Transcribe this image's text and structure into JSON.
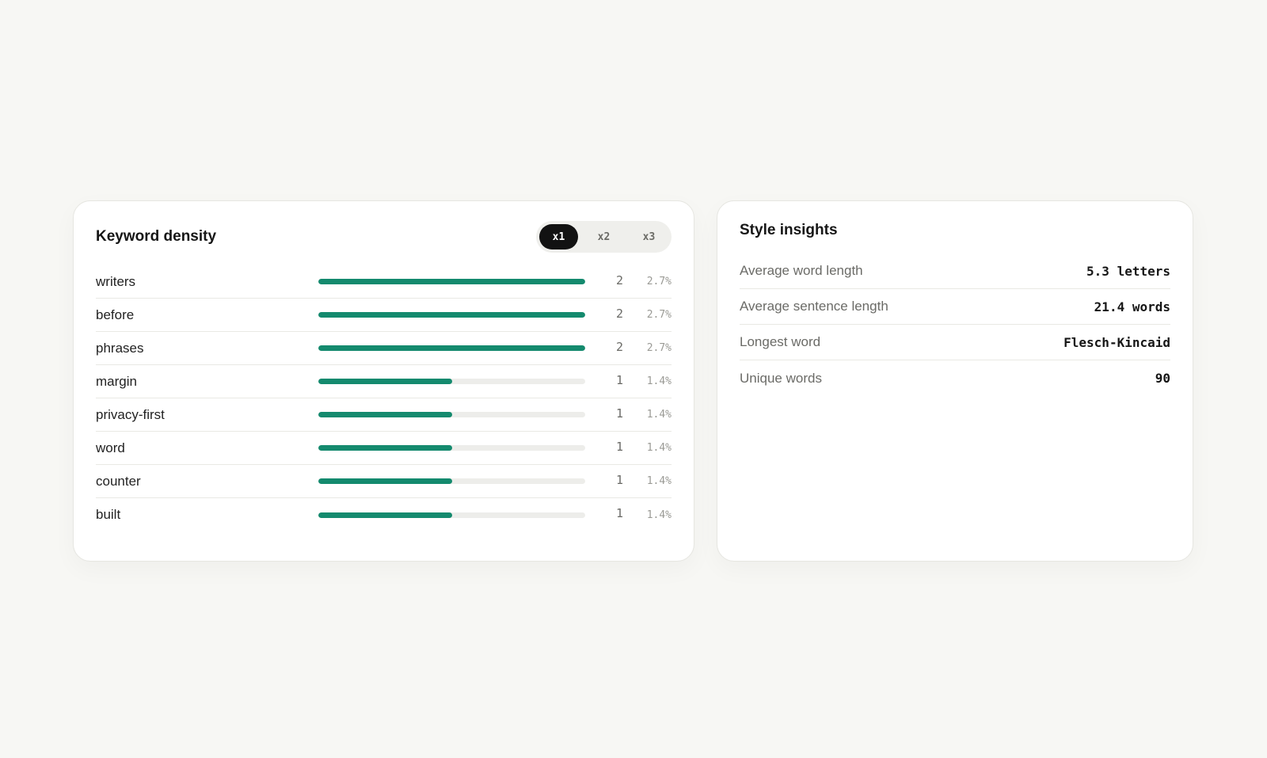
{
  "keyword_density": {
    "title": "Keyword density",
    "toggle": {
      "options": [
        "x1",
        "x2",
        "x3"
      ],
      "selected": "x1"
    },
    "rows": [
      {
        "word": "writers",
        "count": "2",
        "percent": "2.7%",
        "level": 1.0
      },
      {
        "word": "before",
        "count": "2",
        "percent": "2.7%",
        "level": 1.0
      },
      {
        "word": "phrases",
        "count": "2",
        "percent": "2.7%",
        "level": 1.0
      },
      {
        "word": "margin",
        "count": "1",
        "percent": "1.4%",
        "level": 0.5
      },
      {
        "word": "privacy-first",
        "count": "1",
        "percent": "1.4%",
        "level": 0.5
      },
      {
        "word": "word",
        "count": "1",
        "percent": "1.4%",
        "level": 0.5
      },
      {
        "word": "counter",
        "count": "1",
        "percent": "1.4%",
        "level": 0.5
      },
      {
        "word": "built",
        "count": "1",
        "percent": "1.4%",
        "level": 0.5
      }
    ],
    "bar_color": "#148a6e"
  },
  "style_insights": {
    "title": "Style insights",
    "rows": [
      {
        "label": "Average word length",
        "value": "5.3 letters"
      },
      {
        "label": "Average sentence length",
        "value": "21.4 words"
      },
      {
        "label": "Longest word",
        "value": "Flesch-Kincaid"
      },
      {
        "label": "Unique words",
        "value": "90"
      }
    ]
  }
}
